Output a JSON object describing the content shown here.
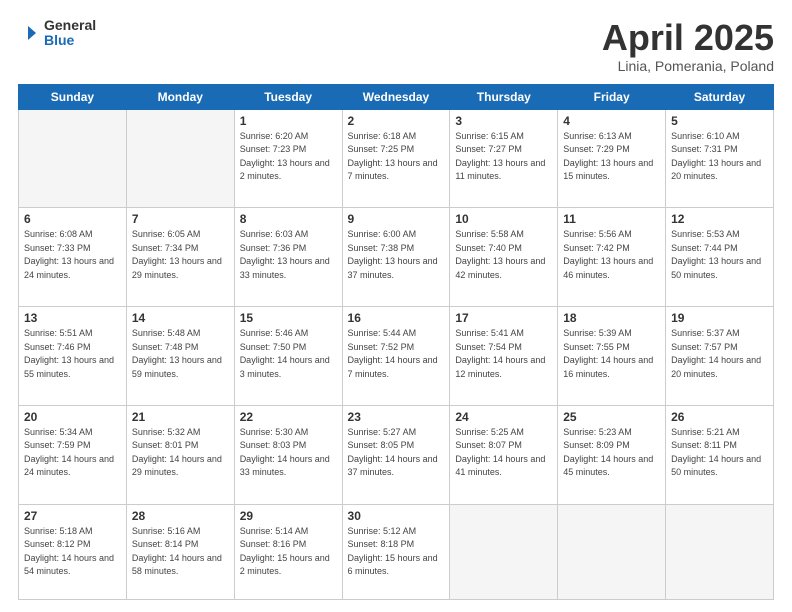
{
  "header": {
    "logo_line1": "General",
    "logo_line2": "Blue",
    "month": "April 2025",
    "location": "Linia, Pomerania, Poland"
  },
  "days_of_week": [
    "Sunday",
    "Monday",
    "Tuesday",
    "Wednesday",
    "Thursday",
    "Friday",
    "Saturday"
  ],
  "weeks": [
    [
      {
        "day": "",
        "info": ""
      },
      {
        "day": "",
        "info": ""
      },
      {
        "day": "1",
        "info": "Sunrise: 6:20 AM\nSunset: 7:23 PM\nDaylight: 13 hours and 2 minutes."
      },
      {
        "day": "2",
        "info": "Sunrise: 6:18 AM\nSunset: 7:25 PM\nDaylight: 13 hours and 7 minutes."
      },
      {
        "day": "3",
        "info": "Sunrise: 6:15 AM\nSunset: 7:27 PM\nDaylight: 13 hours and 11 minutes."
      },
      {
        "day": "4",
        "info": "Sunrise: 6:13 AM\nSunset: 7:29 PM\nDaylight: 13 hours and 15 minutes."
      },
      {
        "day": "5",
        "info": "Sunrise: 6:10 AM\nSunset: 7:31 PM\nDaylight: 13 hours and 20 minutes."
      }
    ],
    [
      {
        "day": "6",
        "info": "Sunrise: 6:08 AM\nSunset: 7:33 PM\nDaylight: 13 hours and 24 minutes."
      },
      {
        "day": "7",
        "info": "Sunrise: 6:05 AM\nSunset: 7:34 PM\nDaylight: 13 hours and 29 minutes."
      },
      {
        "day": "8",
        "info": "Sunrise: 6:03 AM\nSunset: 7:36 PM\nDaylight: 13 hours and 33 minutes."
      },
      {
        "day": "9",
        "info": "Sunrise: 6:00 AM\nSunset: 7:38 PM\nDaylight: 13 hours and 37 minutes."
      },
      {
        "day": "10",
        "info": "Sunrise: 5:58 AM\nSunset: 7:40 PM\nDaylight: 13 hours and 42 minutes."
      },
      {
        "day": "11",
        "info": "Sunrise: 5:56 AM\nSunset: 7:42 PM\nDaylight: 13 hours and 46 minutes."
      },
      {
        "day": "12",
        "info": "Sunrise: 5:53 AM\nSunset: 7:44 PM\nDaylight: 13 hours and 50 minutes."
      }
    ],
    [
      {
        "day": "13",
        "info": "Sunrise: 5:51 AM\nSunset: 7:46 PM\nDaylight: 13 hours and 55 minutes."
      },
      {
        "day": "14",
        "info": "Sunrise: 5:48 AM\nSunset: 7:48 PM\nDaylight: 13 hours and 59 minutes."
      },
      {
        "day": "15",
        "info": "Sunrise: 5:46 AM\nSunset: 7:50 PM\nDaylight: 14 hours and 3 minutes."
      },
      {
        "day": "16",
        "info": "Sunrise: 5:44 AM\nSunset: 7:52 PM\nDaylight: 14 hours and 7 minutes."
      },
      {
        "day": "17",
        "info": "Sunrise: 5:41 AM\nSunset: 7:54 PM\nDaylight: 14 hours and 12 minutes."
      },
      {
        "day": "18",
        "info": "Sunrise: 5:39 AM\nSunset: 7:55 PM\nDaylight: 14 hours and 16 minutes."
      },
      {
        "day": "19",
        "info": "Sunrise: 5:37 AM\nSunset: 7:57 PM\nDaylight: 14 hours and 20 minutes."
      }
    ],
    [
      {
        "day": "20",
        "info": "Sunrise: 5:34 AM\nSunset: 7:59 PM\nDaylight: 14 hours and 24 minutes."
      },
      {
        "day": "21",
        "info": "Sunrise: 5:32 AM\nSunset: 8:01 PM\nDaylight: 14 hours and 29 minutes."
      },
      {
        "day": "22",
        "info": "Sunrise: 5:30 AM\nSunset: 8:03 PM\nDaylight: 14 hours and 33 minutes."
      },
      {
        "day": "23",
        "info": "Sunrise: 5:27 AM\nSunset: 8:05 PM\nDaylight: 14 hours and 37 minutes."
      },
      {
        "day": "24",
        "info": "Sunrise: 5:25 AM\nSunset: 8:07 PM\nDaylight: 14 hours and 41 minutes."
      },
      {
        "day": "25",
        "info": "Sunrise: 5:23 AM\nSunset: 8:09 PM\nDaylight: 14 hours and 45 minutes."
      },
      {
        "day": "26",
        "info": "Sunrise: 5:21 AM\nSunset: 8:11 PM\nDaylight: 14 hours and 50 minutes."
      }
    ],
    [
      {
        "day": "27",
        "info": "Sunrise: 5:18 AM\nSunset: 8:12 PM\nDaylight: 14 hours and 54 minutes."
      },
      {
        "day": "28",
        "info": "Sunrise: 5:16 AM\nSunset: 8:14 PM\nDaylight: 14 hours and 58 minutes."
      },
      {
        "day": "29",
        "info": "Sunrise: 5:14 AM\nSunset: 8:16 PM\nDaylight: 15 hours and 2 minutes."
      },
      {
        "day": "30",
        "info": "Sunrise: 5:12 AM\nSunset: 8:18 PM\nDaylight: 15 hours and 6 minutes."
      },
      {
        "day": "",
        "info": ""
      },
      {
        "day": "",
        "info": ""
      },
      {
        "day": "",
        "info": ""
      }
    ]
  ]
}
